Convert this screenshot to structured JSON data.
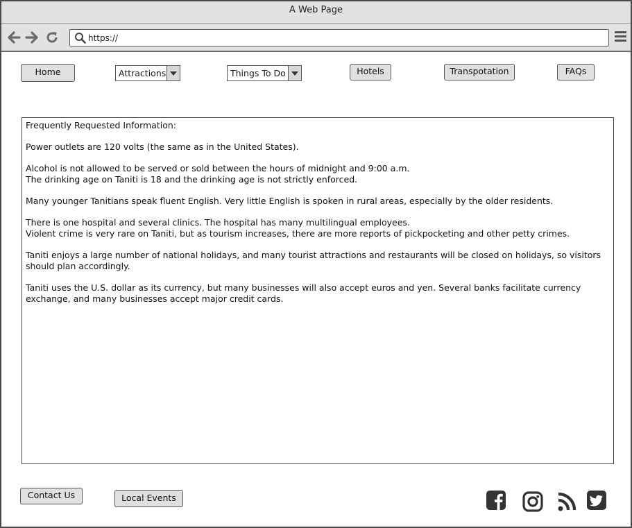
{
  "window": {
    "title": "A Web Page"
  },
  "browser": {
    "url": "https://"
  },
  "nav": {
    "home": "Home",
    "attractions": "Attractions",
    "things_to_do": "Things To Do",
    "hotels": "Hotels",
    "transportation": "Transpotation",
    "faqs": "FAQs"
  },
  "content": {
    "heading": "Frequently Requested Information:",
    "p1": "Power outlets are 120 volts (the same as in the United States).",
    "p2a": "Alcohol is not allowed to be served or sold between the hours of midnight and 9:00 a.m.",
    "p2b": "The drinking age on Taniti is 18 and the drinking age is not strictly enforced.",
    "p3": "Many younger Tanitians speak fluent English. Very little English is spoken in rural areas, especially by the older residents.",
    "p4a": "There is one hospital and several clinics. The hospital has many multilingual employees.",
    "p4b": "Violent crime is very rare on Taniti, but as tourism increases, there are more reports of pickpocketing and other petty crimes.",
    "p5": "Taniti enjoys a large number of national holidays, and many tourist attractions and restaurants will be closed on holidays, so visitors should plan accordingly.",
    "p6": "Taniti uses the U.S. dollar as its currency, but many businesses will also accept euros and yen. Several banks facilitate currency exchange, and many businesses accept major credit cards."
  },
  "footer": {
    "contact": "Contact Us",
    "events": "Local Events"
  },
  "icons": {
    "back": "arrow-left-icon",
    "forward": "arrow-right-icon",
    "reload": "reload-icon",
    "search": "search-icon",
    "menu": "hamburger-menu-icon",
    "facebook": "facebook-icon",
    "instagram": "instagram-icon",
    "rss": "rss-icon",
    "twitter": "twitter-icon"
  },
  "colors": {
    "chrome": "#e2e2e2",
    "button": "#e0e0e0",
    "border": "#555555",
    "icon": "#333333"
  }
}
